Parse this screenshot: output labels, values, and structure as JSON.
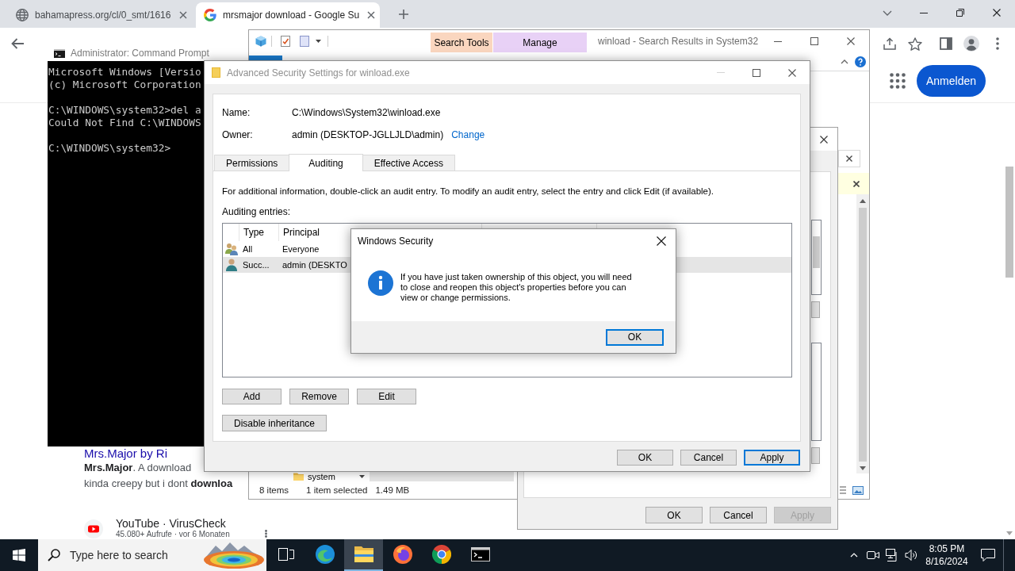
{
  "browser": {
    "tabs": [
      {
        "title": "bahamapress.org/cl/0_smt/1616",
        "selected": false
      },
      {
        "title": "mrsmajor download - Google Su",
        "selected": true
      }
    ],
    "sign_in_button": "Anmelden",
    "result": {
      "heading": "Mrs.Major by Ri",
      "snippet_lines": [
        "**Mrs.Major**. A download",
        "kinda creepy but i dont **downloa**"
      ]
    },
    "video_result": {
      "source": "YouTube · VirusCheck",
      "meta": "45.080+ Aufrufe · vor 6 Monaten"
    }
  },
  "explorer": {
    "title": "winload - Search Results in System32",
    "context_tabs": [
      {
        "label": "Search Tools",
        "color": "#fad6bf"
      },
      {
        "label": "Manage",
        "color": "#e8d1f6"
      }
    ],
    "folder_item": "system",
    "status_bar": {
      "item_count": "8 items",
      "selection": "1 item selected",
      "size": "1.49 MB"
    }
  },
  "properties": {
    "buttons": [
      {
        "label": "OK",
        "disabled": false
      },
      {
        "label": "Cancel",
        "disabled": false
      },
      {
        "label": "Apply",
        "disabled": true
      }
    ]
  },
  "command_prompt": {
    "title": "Administrator: Command Prompt",
    "blocks": [
      [
        "Microsoft Windows [Versio",
        "(c) Microsoft Corporation"
      ],
      [
        "C:\\WINDOWS\\system32>del a",
        "Could Not Find C:\\WINDOWS"
      ],
      [
        "C:\\WINDOWS\\system32>"
      ]
    ]
  },
  "advanced_security": {
    "title": "Advanced Security Settings for winload.exe",
    "fields": [
      {
        "label": "Name:",
        "value": "C:\\Windows\\System32\\winload.exe"
      },
      {
        "label": "Owner:",
        "value": "admin (DESKTOP-JGLLJLD\\admin)",
        "link": "Change"
      }
    ],
    "tabs": [
      {
        "label": "Permissions",
        "selected": false
      },
      {
        "label": "Auditing",
        "selected": true
      },
      {
        "label": "Effective Access",
        "selected": false
      }
    ],
    "info": "For additional information, double-click an audit entry. To modify an audit entry, select the entry and click Edit (if available).",
    "entries_label": "Auditing entries:",
    "table": {
      "columns": [
        "Type",
        "Principal"
      ],
      "rows": [
        {
          "kind": "group",
          "type": "All",
          "principal": "Everyone",
          "selected": false
        },
        {
          "kind": "user",
          "type": "Succ...",
          "principal": "admin (DESKTO",
          "selected": true
        }
      ]
    },
    "entry_buttons": [
      "Add",
      "Remove",
      "Edit"
    ],
    "inheritance_button": "Disable inheritance",
    "footer_buttons": [
      {
        "label": "OK",
        "default": false
      },
      {
        "label": "Cancel",
        "default": false
      },
      {
        "label": "Apply",
        "default": true
      }
    ]
  },
  "message_box": {
    "title": "Windows Security",
    "message": "If you have just taken ownership of this object, you will need to close and reopen this object's properties before you can view or change permissions.",
    "button": "OK"
  },
  "taskbar": {
    "search": {
      "placeholder": "Type here to search"
    },
    "apps": [
      {
        "kind": "task-view",
        "active": false
      },
      {
        "kind": "edge",
        "active": false
      },
      {
        "kind": "explorer",
        "active": true
      },
      {
        "kind": "firefox",
        "active": false
      },
      {
        "kind": "chrome",
        "active": false
      },
      {
        "kind": "terminal",
        "active": false
      }
    ],
    "time": "8:05 PM",
    "date": "8/16/2024"
  }
}
